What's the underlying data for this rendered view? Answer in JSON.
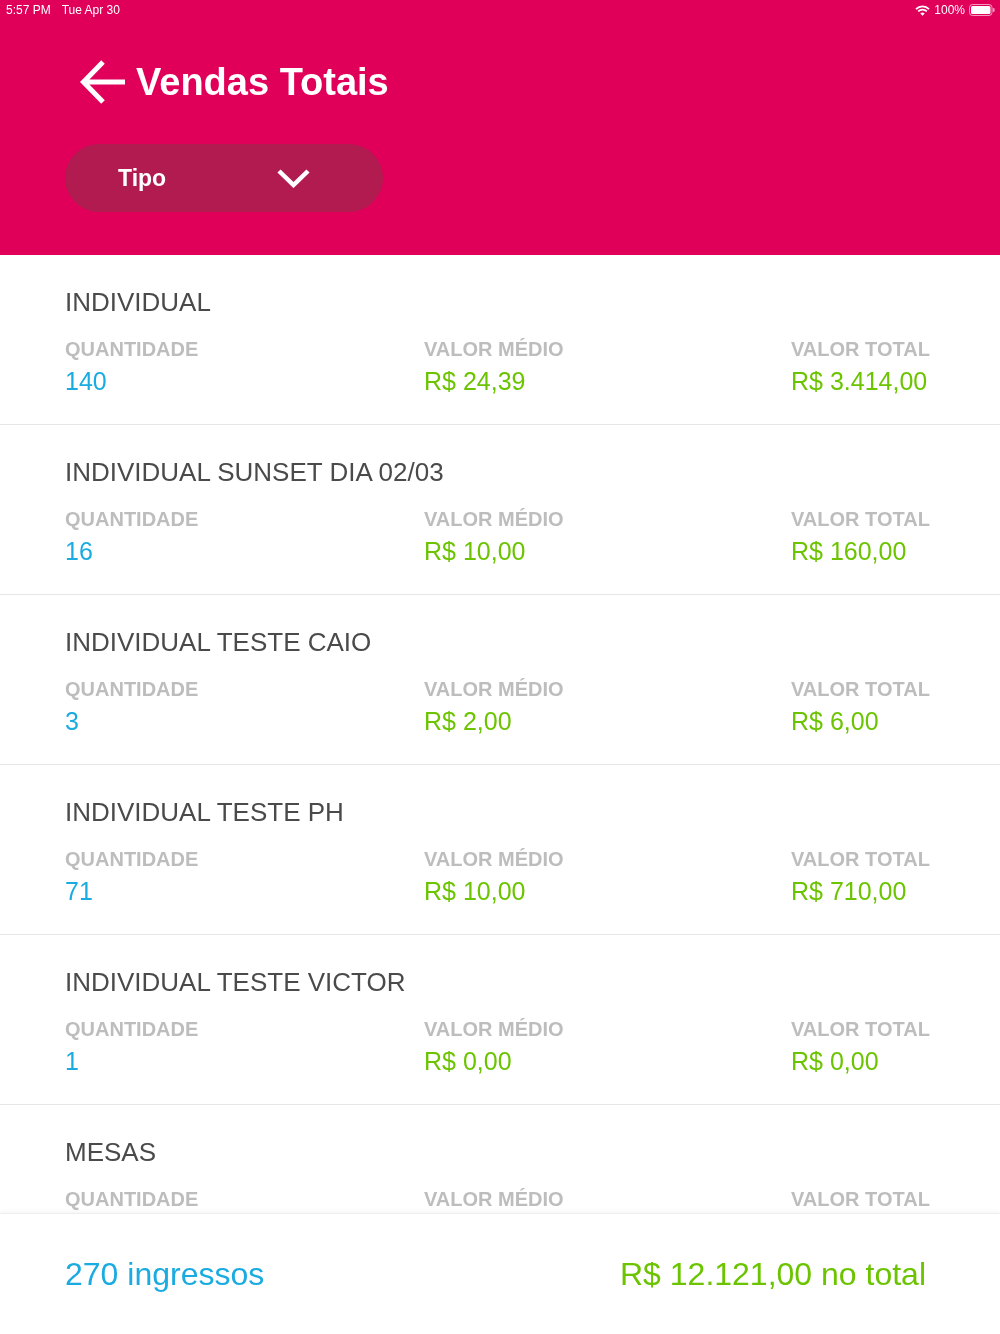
{
  "status_bar": {
    "time": "5:57 PM",
    "date": "Tue Apr 30",
    "battery": "100%"
  },
  "header": {
    "title": "Vendas Totais",
    "filter": {
      "label": "Tipo"
    }
  },
  "sales": [
    {
      "name": "INDIVIDUAL",
      "fields": [
        {
          "kind": "count",
          "label": "QUANTIDADE",
          "value": "140"
        },
        {
          "kind": "money",
          "label": "VALOR MÉDIO",
          "value": "R$ 24,39"
        },
        {
          "kind": "money",
          "label": "VALOR TOTAL",
          "value": "R$ 3.414,00"
        }
      ]
    },
    {
      "name": "INDIVIDUAL SUNSET DIA 02/03",
      "fields": [
        {
          "kind": "count",
          "label": "QUANTIDADE",
          "value": "16"
        },
        {
          "kind": "money",
          "label": "VALOR MÉDIO",
          "value": "R$ 10,00"
        },
        {
          "kind": "money",
          "label": "VALOR TOTAL",
          "value": "R$ 160,00"
        }
      ]
    },
    {
      "name": "INDIVIDUAL TESTE CAIO",
      "fields": [
        {
          "kind": "count",
          "label": "QUANTIDADE",
          "value": "3"
        },
        {
          "kind": "money",
          "label": "VALOR MÉDIO",
          "value": "R$ 2,00"
        },
        {
          "kind": "money",
          "label": "VALOR TOTAL",
          "value": "R$ 6,00"
        }
      ]
    },
    {
      "name": "INDIVIDUAL TESTE PH",
      "fields": [
        {
          "kind": "count",
          "label": "QUANTIDADE",
          "value": "71"
        },
        {
          "kind": "money",
          "label": "VALOR MÉDIO",
          "value": "R$ 10,00"
        },
        {
          "kind": "money",
          "label": "VALOR TOTAL",
          "value": "R$ 710,00"
        }
      ]
    },
    {
      "name": "INDIVIDUAL TESTE VICTOR",
      "fields": [
        {
          "kind": "count",
          "label": "QUANTIDADE",
          "value": "1"
        },
        {
          "kind": "money",
          "label": "VALOR MÉDIO",
          "value": "R$ 0,00"
        },
        {
          "kind": "money",
          "label": "VALOR TOTAL",
          "value": "R$ 0,00"
        }
      ]
    },
    {
      "name": "MESAS",
      "fields": [
        {
          "label": "QUANTIDADE"
        },
        {
          "label": "VALOR MÉDIO"
        },
        {
          "label": "VALOR TOTAL"
        }
      ]
    }
  ],
  "footer": {
    "ticket_count": "270 ingressos",
    "total": "R$ 12.121,00 no total"
  }
}
